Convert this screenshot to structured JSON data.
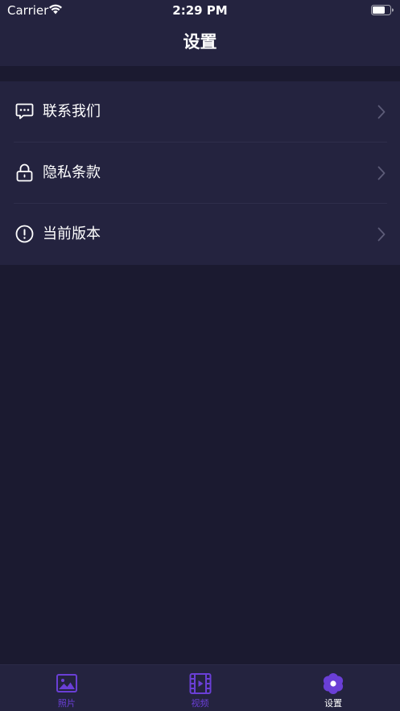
{
  "status_bar": {
    "carrier": "Carrier",
    "time": "2:29 PM",
    "wifi_icon": "wifi-icon",
    "battery_icon": "battery-icon"
  },
  "nav": {
    "title": "设置"
  },
  "settings": {
    "items": [
      {
        "label": "联系我们",
        "icon": "message-icon"
      },
      {
        "label": "隐私条款",
        "icon": "lock-icon"
      },
      {
        "label": "当前版本",
        "icon": "info-icon"
      }
    ],
    "chevron_icon": "chevron-right-icon"
  },
  "tab_bar": {
    "items": [
      {
        "label": "照片",
        "icon": "photo-icon",
        "active": false
      },
      {
        "label": "视频",
        "icon": "film-icon",
        "active": false
      },
      {
        "label": "设置",
        "icon": "flower-settings-icon",
        "active": true
      }
    ]
  },
  "colors": {
    "background": "#1b1a30",
    "surface": "#24233f",
    "accent": "#6a3fd6",
    "divider": "#2f2e4b",
    "text": "#ffffff"
  }
}
